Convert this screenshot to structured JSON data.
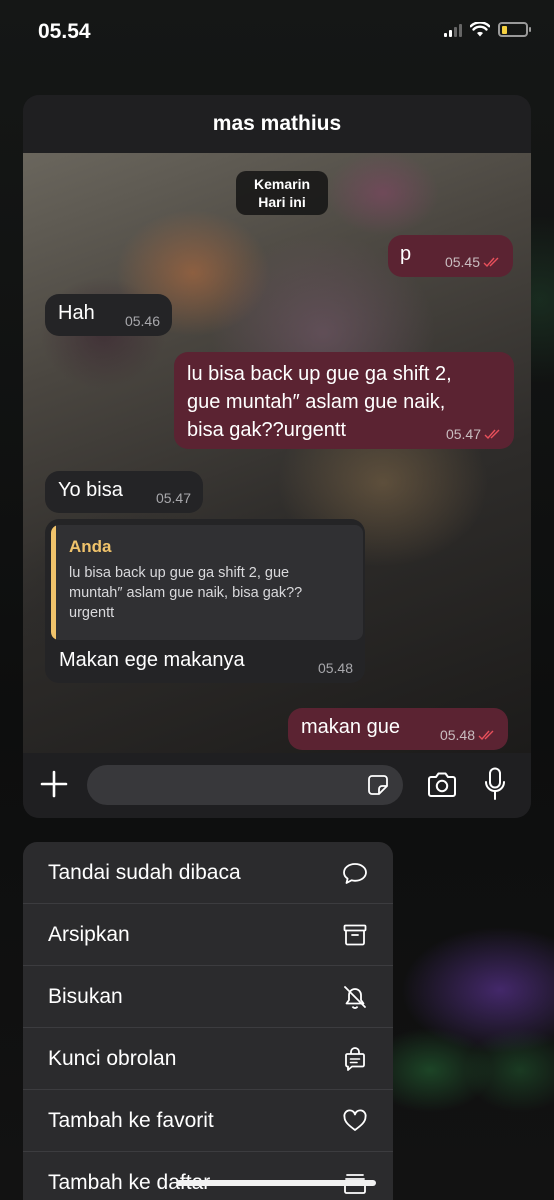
{
  "status_bar": {
    "time": "05.54",
    "battery_level": 0.25
  },
  "chat": {
    "title": "mas mathius",
    "date_chip": {
      "line1": "Kemarin",
      "line2": "Hari ini"
    },
    "messages": [
      {
        "direction": "out",
        "text": "p",
        "time": "05.45",
        "read": true
      },
      {
        "direction": "in",
        "text": "Hah",
        "time": "05.46"
      },
      {
        "direction": "out",
        "text_lines": [
          "lu bisa back up gue ga shift 2,",
          "gue muntah″ aslam gue naik,",
          "bisa gak??urgentt"
        ],
        "time": "05.47",
        "read": true
      },
      {
        "direction": "in",
        "text": "Yo bisa",
        "time": "05.47"
      },
      {
        "direction": "in",
        "text": "Makan ege makanya",
        "time": "05.48",
        "reply": {
          "author": "Anda",
          "text_lines": [
            "lu bisa back up gue ga shift 2, gue",
            "muntah″ aslam gue naik, bisa gak??",
            "urgentt"
          ]
        }
      },
      {
        "direction": "out",
        "text": "makan gue",
        "time": "05.48",
        "read": true
      }
    ],
    "input_icons": [
      "plus-icon",
      "sticker-icon",
      "camera-icon",
      "mic-icon"
    ]
  },
  "context_menu": {
    "items": [
      {
        "label": "Tandai sudah dibaca",
        "icon": "chat-bubble-icon"
      },
      {
        "label": "Arsipkan",
        "icon": "archive-icon"
      },
      {
        "label": "Bisukan",
        "icon": "bell-slash-icon"
      },
      {
        "label": "Kunci obrolan",
        "icon": "lock-chat-icon"
      },
      {
        "label": "Tambah ke favorit",
        "icon": "heart-icon"
      },
      {
        "label": "Tambah ke daftar",
        "icon": "list-add-icon"
      }
    ]
  },
  "colors": {
    "outgoing_bubble": "#5b2332",
    "incoming_bubble": "#242426",
    "reply_accent": "#f0c36b",
    "read_ticks": "#e8505b",
    "menu_background": "#2b2b2d"
  }
}
